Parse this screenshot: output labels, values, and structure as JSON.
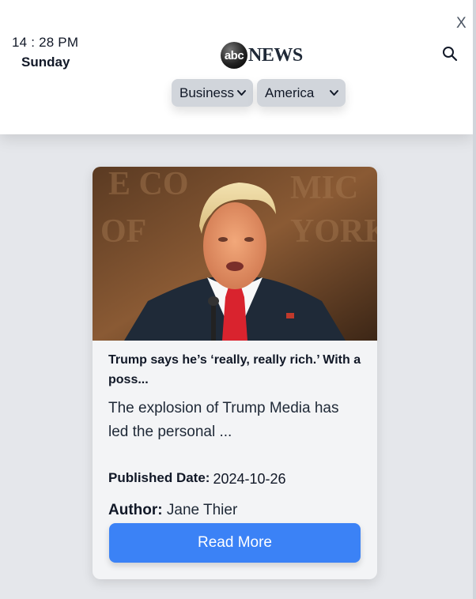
{
  "header": {
    "time": "14 : 28 PM",
    "day": "Sunday",
    "logo_abc": "abc",
    "logo_news": "NEWS",
    "close_label": "X",
    "search_icon": "search-icon",
    "category_select": {
      "selected": "Business"
    },
    "country_select": {
      "selected": "America"
    }
  },
  "article": {
    "image_alt": "Trump speaking at a podium in front of an Economic Club of New York backdrop",
    "title": "Trump says he’s ‘really, really rich.’ With a poss...",
    "description": "The explosion of Trump Media has led the personal ...",
    "published_label": "Published Date:",
    "published_value": "2024-10-26",
    "author_label": "Author:",
    "author_value": "Jane Thier",
    "read_more_label": "Read More"
  },
  "colors": {
    "page_background": "#e5e7eb",
    "header_background": "#ffffff",
    "select_background": "#d1d5db",
    "card_background": "#f3f4f6",
    "button_background": "#3b82f6",
    "button_text": "#ffffff"
  }
}
